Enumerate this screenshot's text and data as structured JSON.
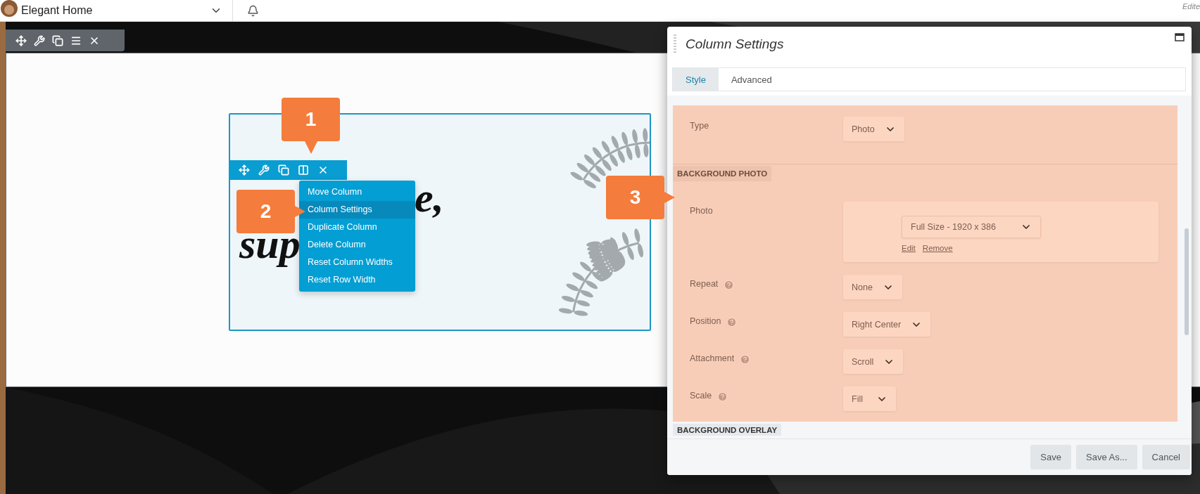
{
  "top_bar": {
    "site_name": "Elegant Home",
    "status": "Edite"
  },
  "column": {
    "heading_fragments": [
      "e,",
      "sup"
    ]
  },
  "column_menu": {
    "items": [
      {
        "label": "Move Column",
        "selected": false
      },
      {
        "label": "Column Settings",
        "selected": true
      },
      {
        "label": "Duplicate Column",
        "selected": false
      },
      {
        "label": "Delete Column",
        "selected": false
      },
      {
        "label": "Reset Column Widths",
        "selected": false
      },
      {
        "label": "Reset Row Width",
        "selected": false
      }
    ]
  },
  "callouts": [
    "1",
    "2",
    "3"
  ],
  "settings_panel": {
    "title": "Column Settings",
    "tabs": [
      {
        "label": "Style",
        "selected": true
      },
      {
        "label": "Advanced",
        "selected": false
      }
    ],
    "rows": [
      {
        "kind": "select",
        "label": "Type",
        "help": false,
        "value": "Photo"
      },
      {
        "kind": "heading",
        "label": "BACKGROUND PHOTO"
      },
      {
        "label": "Photo",
        "value": "Full Size - 1920 x 386",
        "links": [
          "Edit",
          "Remove"
        ]
      },
      {
        "kind": "select",
        "label": "Repeat",
        "help": true,
        "value": "None"
      },
      {
        "kind": "select",
        "label": "Position",
        "help": true,
        "value": "Right Center"
      },
      {
        "kind": "select",
        "label": "Attachment",
        "help": true,
        "value": "Scroll"
      },
      {
        "kind": "select",
        "label": "Scale",
        "help": true,
        "value": "Fill"
      }
    ],
    "next_heading": "BACKGROUND OVERLAY",
    "buttons": [
      "Save",
      "Save As...",
      "Cancel"
    ]
  }
}
